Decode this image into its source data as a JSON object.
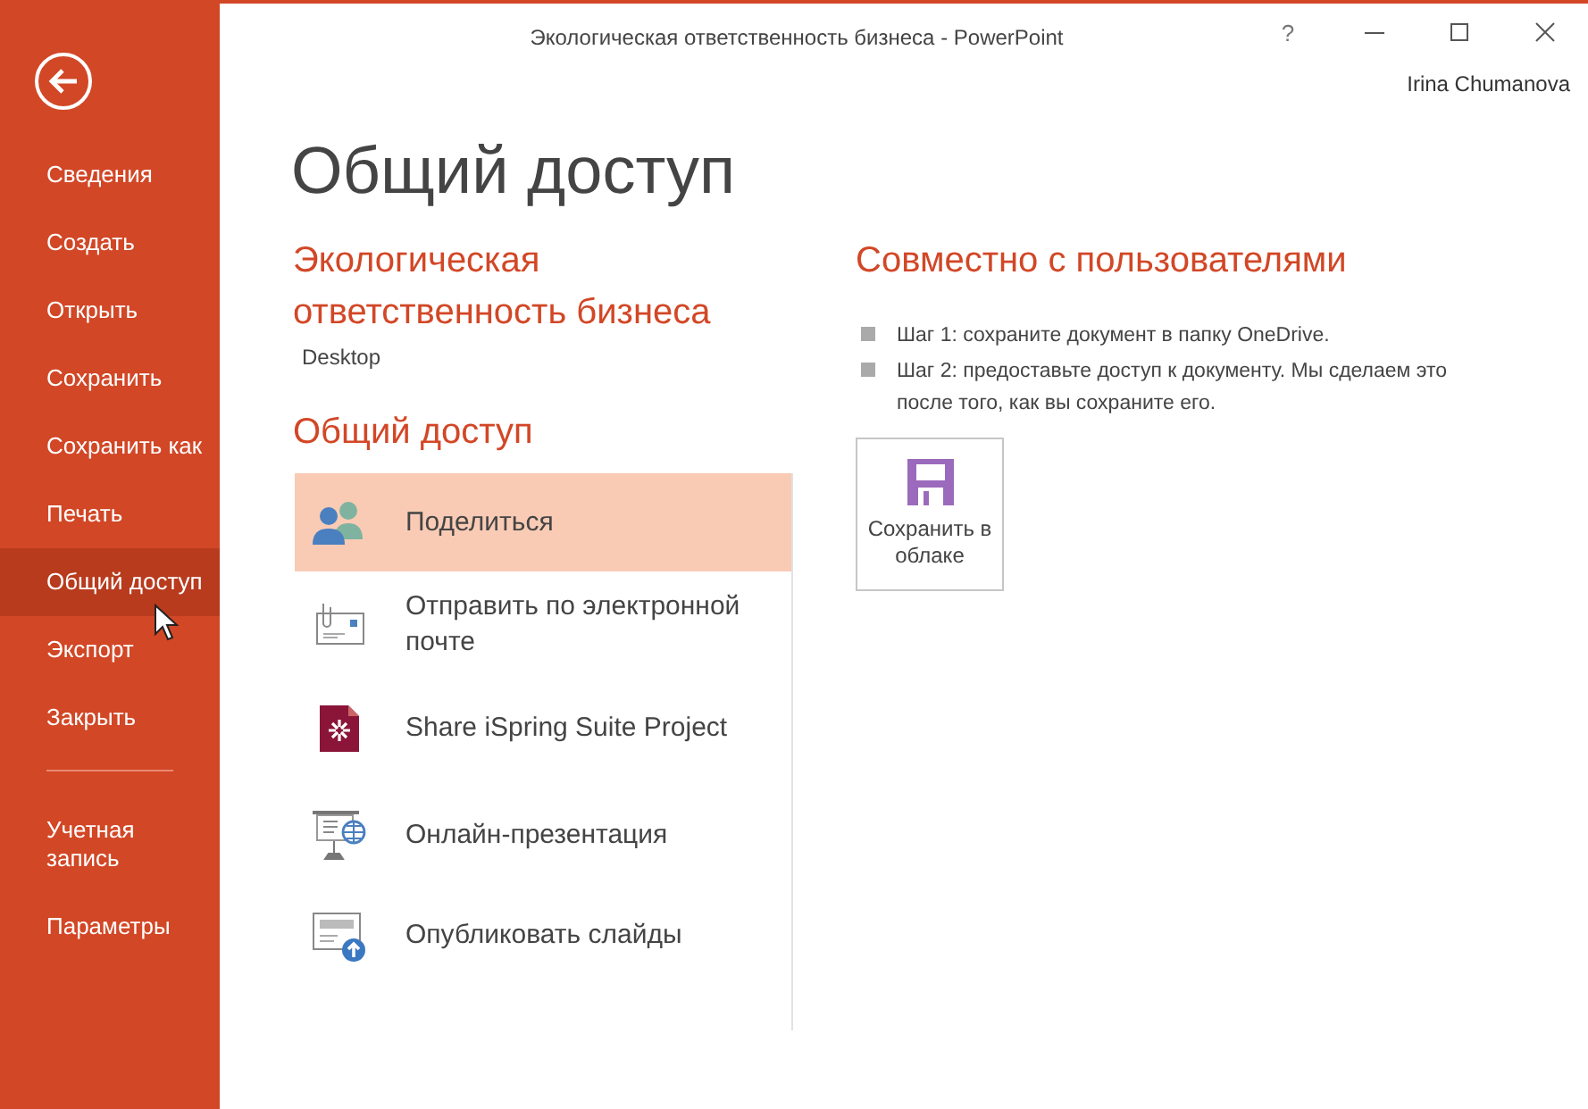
{
  "window": {
    "title": "Экологическая ответственность бизнеса - PowerPoint",
    "help": "?",
    "user": "Irina Chumanova"
  },
  "sidebar": {
    "items": [
      {
        "label": "Сведения",
        "selected": false
      },
      {
        "label": "Создать",
        "selected": false
      },
      {
        "label": "Открыть",
        "selected": false
      },
      {
        "label": "Сохранить",
        "selected": false
      },
      {
        "label": "Сохранить как",
        "selected": false
      },
      {
        "label": "Печать",
        "selected": false
      },
      {
        "label": "Общий доступ",
        "selected": true
      },
      {
        "label": "Экспорт",
        "selected": false
      },
      {
        "label": "Закрыть",
        "selected": false
      }
    ],
    "footer_items": [
      {
        "label": "Учетная запись",
        "selected": false
      },
      {
        "label": "Параметры",
        "selected": false
      }
    ]
  },
  "page_title": "Общий доступ",
  "document": {
    "name": "Экологическая ответственность бизнеса",
    "location": "Desktop"
  },
  "share": {
    "title": "Общий доступ",
    "options": [
      {
        "kind": "people",
        "label": "Поделиться",
        "selected": true
      },
      {
        "kind": "email",
        "label": "Отправить по электронной почте",
        "selected": false
      },
      {
        "kind": "ispring",
        "label": "Share iSpring Suite Project",
        "selected": false
      },
      {
        "kind": "online",
        "label": "Онлайн-презентация",
        "selected": false
      },
      {
        "kind": "publish",
        "label": "Опубликовать слайды",
        "selected": false
      }
    ]
  },
  "detail": {
    "title": "Совместно с пользователями",
    "steps": [
      "Шаг 1: сохраните документ в папку OneDrive.",
      "Шаг 2: предоставьте доступ к документу. Мы сделаем это после того, как вы сохраните его."
    ],
    "button": {
      "label": "Сохранить в облаке"
    }
  }
}
